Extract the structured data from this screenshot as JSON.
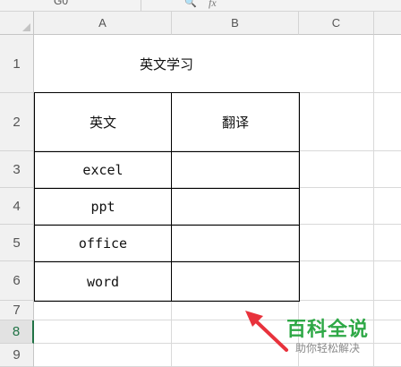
{
  "formula_bar": {
    "name_box": "G0",
    "fx": "fx"
  },
  "columns": [
    "A",
    "B",
    "C"
  ],
  "rows": [
    "1",
    "2",
    "3",
    "4",
    "5",
    "6",
    "7",
    "8",
    "9"
  ],
  "table": {
    "title": "英文学习",
    "headers": [
      "英文",
      "翻译"
    ],
    "words": [
      {
        "en": "excel",
        "cn": ""
      },
      {
        "en": "ppt",
        "cn": ""
      },
      {
        "en": "office",
        "cn": ""
      },
      {
        "en": "word",
        "cn": ""
      }
    ]
  },
  "selected_row": "8",
  "watermark": {
    "title": "百科全说",
    "subtitle": "助你轻松解决"
  },
  "colors": {
    "accent": "#217346",
    "arrow": "#e8323c",
    "watermark": "#2ea846"
  }
}
